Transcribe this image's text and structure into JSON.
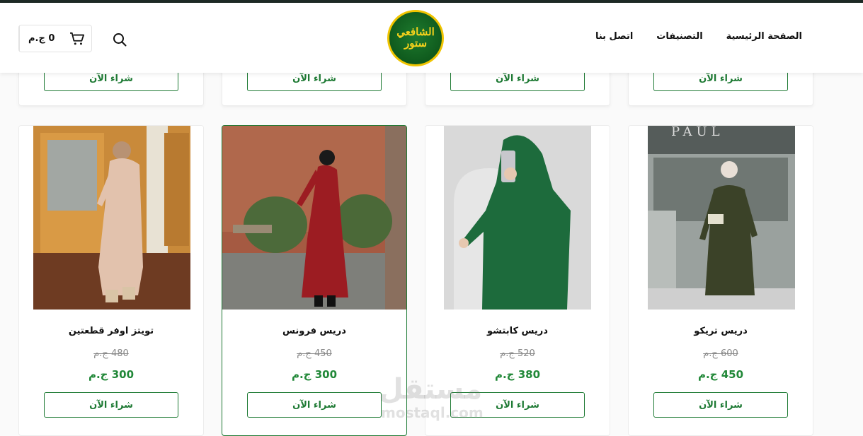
{
  "header": {
    "nav": [
      "الصفحة الرئيسية",
      "التصنيفات",
      "اتصل بنا"
    ],
    "logo": {
      "line1": "الشافعي",
      "line2": "ستور"
    },
    "cart_total": "0 ج.م",
    "icons": {
      "cart": "cart-icon",
      "search": "search-icon"
    }
  },
  "top_row": {
    "buy_label": "شراء الآن"
  },
  "products": [
    {
      "name": "دريس تريكو",
      "old_price": "600 ج.م",
      "price": "450 ج.م",
      "buy_label": "شراء الآن"
    },
    {
      "name": "دريس كابتشو",
      "old_price": "520 ج.م",
      "price": "380 ج.م",
      "buy_label": "شراء الآن"
    },
    {
      "name": "دريس فرونس",
      "old_price": "450 ج.م",
      "price": "300 ج.م",
      "buy_label": "شراء الآن"
    },
    {
      "name": "تويتز اوفر قطعتين",
      "old_price": "480 ج.م",
      "price": "300 ج.م",
      "buy_label": "شراء الآن"
    }
  ],
  "watermark": {
    "text": "مستقل",
    "sub": "mostaql.com"
  },
  "colors": {
    "accent": "#1e7a34",
    "price": "#218838",
    "logo_gold": "#f0c400"
  }
}
